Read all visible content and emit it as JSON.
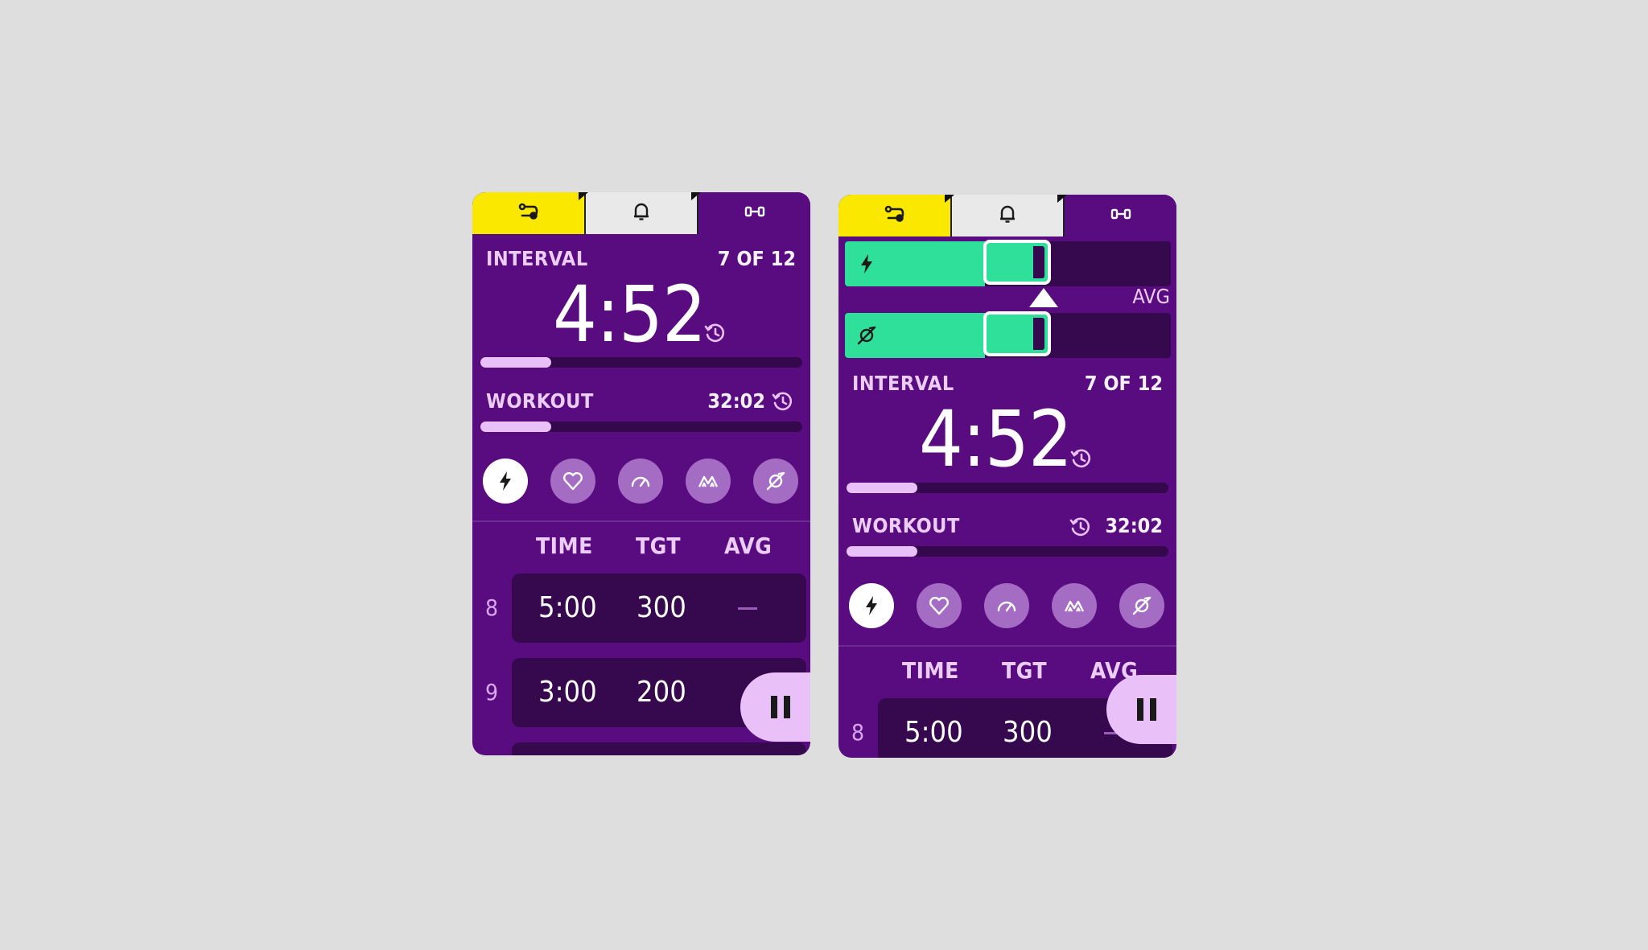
{
  "tabs": [
    {
      "name": "controls",
      "icon": "route-sliders-icon"
    },
    {
      "name": "alerts",
      "icon": "bell-icon"
    },
    {
      "name": "workout",
      "icon": "dumbbell-icon"
    }
  ],
  "interval": {
    "label": "INTERVAL",
    "counter": "7 OF 12",
    "time": "4:52",
    "progress": 0.22
  },
  "workout": {
    "label": "WORKOUT",
    "time": "32:02",
    "progress": 0.22
  },
  "metrics": [
    {
      "name": "power",
      "icon": "lightning-icon",
      "active": true
    },
    {
      "name": "heart-rate",
      "icon": "heart-icon",
      "active": false
    },
    {
      "name": "speed",
      "icon": "speedometer-icon",
      "active": false
    },
    {
      "name": "elevation",
      "icon": "mountain-icon",
      "active": false
    },
    {
      "name": "cadence",
      "icon": "cadence-icon",
      "active": false
    }
  ],
  "table": {
    "headers": {
      "time": "TIME",
      "tgt": "TGT",
      "avg": "AVG"
    },
    "rows": [
      {
        "num": "8",
        "time": "5:00",
        "tgt": "300",
        "avg": "—"
      },
      {
        "num": "9",
        "time": "3:00",
        "tgt": "200",
        "avg": "—"
      }
    ]
  },
  "sliders": {
    "avg_label": "AVG",
    "power_level": 0.43,
    "cadence_level": 0.43
  },
  "colors": {
    "background": "#580c80",
    "accent_yellow": "#fbe800",
    "accent_green": "#2fe09a",
    "accent_lilac": "#e9c0f7",
    "dark_card": "#36094f"
  }
}
